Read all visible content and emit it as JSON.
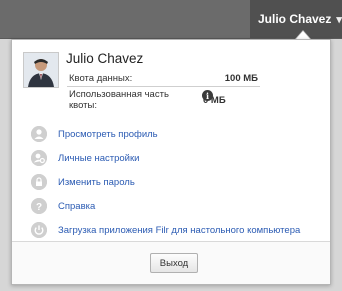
{
  "header": {
    "user_name": "Julio Chavez"
  },
  "profile": {
    "name": "Julio Chavez",
    "quota_label": "Квота данных:",
    "quota_value": "100 МБ",
    "used_label": "Использованная часть квоты:",
    "used_value": "0 МБ"
  },
  "menu": [
    {
      "label": "Просмотреть профиль",
      "icon": "user-icon"
    },
    {
      "label": "Личные настройки",
      "icon": "user-settings-icon"
    },
    {
      "label": "Изменить пароль",
      "icon": "lock-icon"
    },
    {
      "label": "Справка",
      "icon": "help-icon"
    },
    {
      "label": "Загрузка приложения Filr для настольного компьютера",
      "icon": "power-icon"
    }
  ],
  "footer": {
    "logout_label": "Выход"
  }
}
